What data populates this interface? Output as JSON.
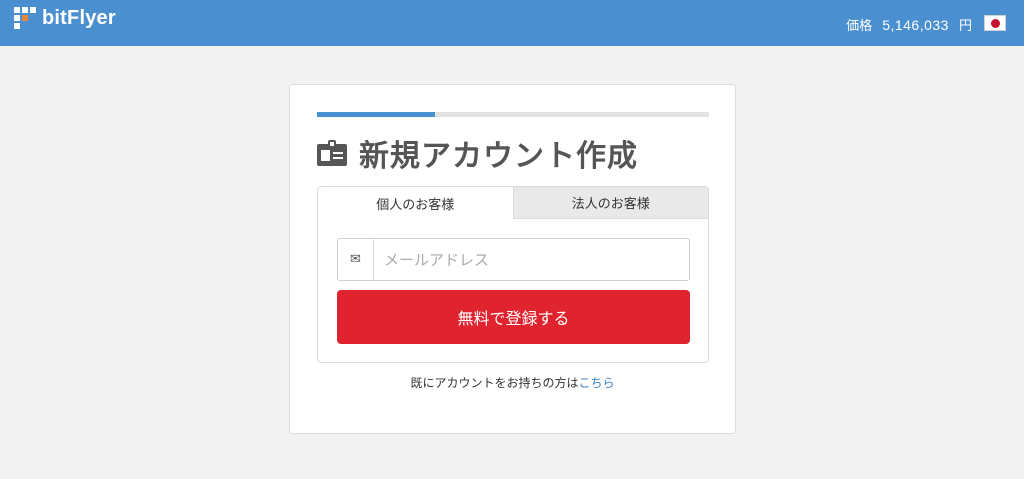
{
  "header": {
    "brand": "bitFlyer",
    "price_label": "価格",
    "price_value": "5,146,033",
    "price_unit": "円",
    "flag_icon": "japan-flag-icon",
    "background": "#4a8fcf"
  },
  "card": {
    "progress": 0.3,
    "title_icon": "id-card-icon",
    "title": "新規アカウント作成",
    "tabs": [
      {
        "label": "個人のお客様",
        "active": true
      },
      {
        "label": "法人のお客様",
        "active": false
      }
    ],
    "email": {
      "icon": "envelope-icon",
      "icon_glyph": "✉",
      "placeholder": "メールアドレス",
      "value": ""
    },
    "submit_label": "無料で登録する",
    "submit_color": "#e0242f",
    "login_prompt": "既にアカウントをお持ちの方は",
    "login_link": "こちら"
  }
}
